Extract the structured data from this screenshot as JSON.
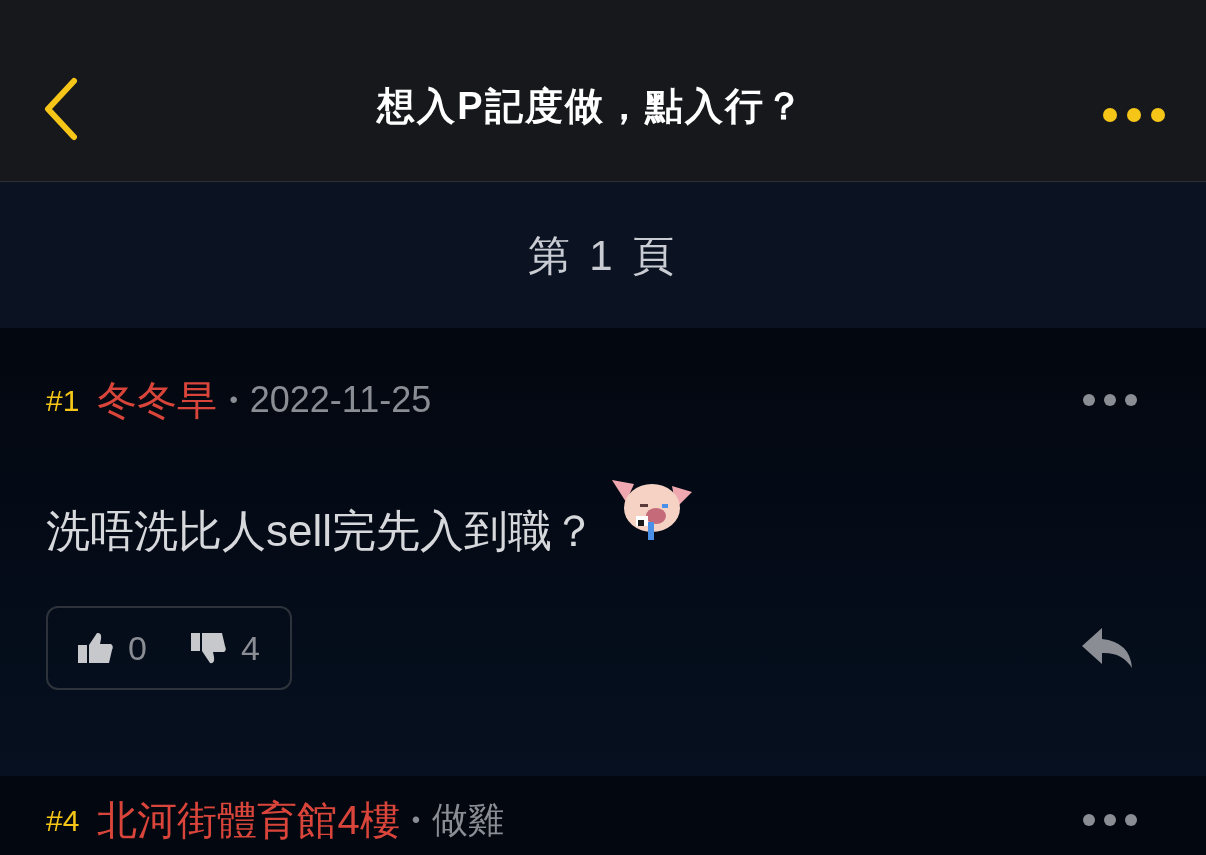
{
  "header": {
    "title": "想入P記度做，點入行？"
  },
  "page_label": "第 1 頁",
  "posts": [
    {
      "number": "#1",
      "user": "冬冬旱",
      "separator": "•",
      "meta": "2022-11-25",
      "body": "洗唔洗比人sell完先入到職？",
      "sticker": true,
      "likes": "0",
      "dislikes": "4"
    },
    {
      "number": "#4",
      "user": "北河街體育館4樓",
      "separator": "•",
      "meta": "做雞"
    }
  ]
}
